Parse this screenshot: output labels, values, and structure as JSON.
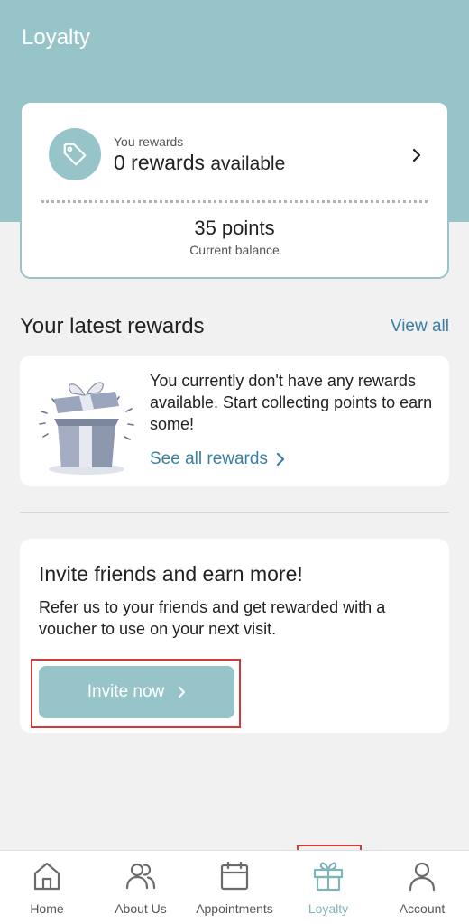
{
  "header": {
    "title": "Loyalty"
  },
  "rewards_card": {
    "subtitle": "You rewards",
    "count": "0 rewards",
    "available": "available",
    "points": "35 points",
    "points_label": "Current balance"
  },
  "latest_rewards": {
    "title": "Your latest rewards",
    "view_all": "View all",
    "empty_message": "You currently don't have any rewards available. Start collecting points to earn some!",
    "see_all": "See all rewards"
  },
  "invite": {
    "title": "Invite friends and earn more!",
    "description": "Refer us to your friends and get rewarded with a voucher to use on your next visit.",
    "button_label": "Invite now"
  },
  "bottom_nav": {
    "items": [
      {
        "label": "Home",
        "icon": "home-icon"
      },
      {
        "label": "About Us",
        "icon": "users-icon"
      },
      {
        "label": "Appointments",
        "icon": "calendar-icon"
      },
      {
        "label": "Loyalty",
        "icon": "gift-icon",
        "active": true
      },
      {
        "label": "Account",
        "icon": "user-icon"
      }
    ]
  },
  "colors": {
    "accent": "#97c4c8",
    "link": "#3a7ea3",
    "highlight": "#d03a3a",
    "background": "#f1f1f1"
  }
}
